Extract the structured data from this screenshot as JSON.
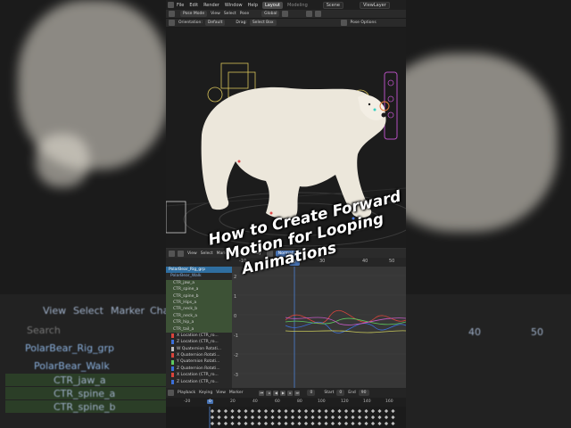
{
  "caption": {
    "line1": "How to Create Forward",
    "line2": "Motion for Looping",
    "line3": "Animations"
  },
  "topbar": {
    "menu": [
      "File",
      "Edit",
      "Render",
      "Window",
      "Help"
    ],
    "workspace_tabs": [
      "Layout",
      "Modeling"
    ],
    "scene": "Scene",
    "view_layer": "ViewLayer"
  },
  "header2": {
    "mode": "Pose Mode",
    "menu": [
      "View",
      "Select",
      "Pose"
    ],
    "transform": "Global"
  },
  "header3": {
    "orientation_label": "Orientation:",
    "orientation_value": "Default",
    "drag_label": "Drag:",
    "drag_value": "Select Box",
    "options": "Pose Options"
  },
  "timeline_header": {
    "menu": [
      "View",
      "Select",
      "Marker",
      "Channel",
      "Key"
    ],
    "normalize": "Normalize"
  },
  "ruler": {
    "current_frame": "0",
    "ticks": [
      "-10",
      "10",
      "20",
      "30",
      "40",
      "50"
    ]
  },
  "channels": {
    "group": "PolarBear_Rig_grp",
    "action": "PolarBear_Walk",
    "bones": [
      "CTR_jaw_a",
      "CTR_spine_a",
      "CTR_spine_b",
      "CTR_Hips_a",
      "CTR_neck_b",
      "CTR_neck_a",
      "CTR_hip_a",
      "CTR_tail_a"
    ],
    "curves": [
      {
        "label": "X Location (CTR_ro...",
        "color": "#d9443b"
      },
      {
        "label": "Z Location (CTR_ro...",
        "color": "#3b6fd9"
      },
      {
        "label": "W Quaternion Rotati...",
        "color": "#bdbdbd"
      },
      {
        "label": "X Quaternion Rotati...",
        "color": "#d9443b"
      },
      {
        "label": "Y Quaternion Rotati...",
        "color": "#5ec95e"
      },
      {
        "label": "Z Quaternion Rotati...",
        "color": "#3b6fd9"
      },
      {
        "label": "X Location (CTR_ro...",
        "color": "#d9443b"
      },
      {
        "label": "Z Location (CTR_ro...",
        "color": "#3b6fd9"
      },
      {
        "label": "X Scale (CTR_root_...",
        "color": "#d9443b"
      },
      {
        "label": "Y Scale (CTR_root_...",
        "color": "#5ec95e"
      }
    ]
  },
  "graph": {
    "y_ticks": [
      "2",
      "1",
      "0",
      "-1",
      "-2",
      "-3"
    ]
  },
  "playback": {
    "menu": [
      "Playback",
      "Keying",
      "View",
      "Marker"
    ],
    "current": "0",
    "start_label": "Start",
    "start": "0",
    "end_label": "End",
    "end": "90"
  },
  "bottom_ruler": {
    "current": "0",
    "ticks": [
      "-20",
      "20",
      "40",
      "60",
      "80",
      "100",
      "120",
      "140",
      "160"
    ]
  },
  "background": {
    "menu": [
      "View",
      "Select",
      "Marker",
      "Cha"
    ],
    "search_placeholder": "Search",
    "rig": "PolarBear_Rig_grp",
    "action": "PolarBear_Walk",
    "bones": [
      "CTR_jaw_a",
      "CTR_spine_a",
      "CTR_spine_b"
    ],
    "right_ticks": [
      "40",
      "50"
    ]
  }
}
